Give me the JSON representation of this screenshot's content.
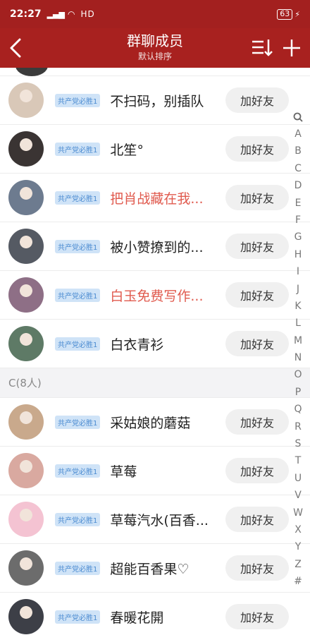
{
  "status": {
    "time": "22:27",
    "network": "HD",
    "battery": "63"
  },
  "header": {
    "title": "群聊成员",
    "subtitle": "默认排序"
  },
  "members_top": [
    {
      "name": "不扫码，别插队",
      "badge": "共产党必胜1",
      "button": "加好友",
      "highlight": false,
      "avatar_color": "#d9c8b8"
    },
    {
      "name": "北笙°",
      "badge": "共产党必胜1",
      "button": "加好友",
      "highlight": false,
      "avatar_color": "#3a3433"
    },
    {
      "name": "把肖战藏在我...",
      "badge": "共产党必胜1",
      "button": "加好友",
      "highlight": true,
      "avatar_color": "#6d7b8f"
    },
    {
      "name": "被小赞撩到的...",
      "badge": "共产党必胜1",
      "button": "加好友",
      "highlight": false,
      "avatar_color": "#555a63"
    },
    {
      "name": "白玉免费写作...",
      "badge": "共产党必胜1",
      "button": "加好友",
      "highlight": true,
      "avatar_color": "#8e6f86"
    },
    {
      "name": "白衣青衫",
      "badge": "共产党必胜1",
      "button": "加好友",
      "highlight": false,
      "avatar_color": "#5e7a66"
    }
  ],
  "section_c": {
    "label": "C(8人)"
  },
  "members_c": [
    {
      "name": "采姑娘的蘑菇",
      "badge": "共产党必胜1",
      "button": "加好友",
      "highlight": false,
      "avatar_color": "#c9a98c"
    },
    {
      "name": "草莓",
      "badge": "共产党必胜1",
      "button": "加好友",
      "highlight": false,
      "avatar_color": "#d9a9a0"
    },
    {
      "name": "草莓汽水(百香...",
      "badge": "共产党必胜1",
      "button": "加好友",
      "highlight": false,
      "avatar_color": "#f4c3d2"
    },
    {
      "name": "超能百香果♡",
      "badge": "共产党必胜1",
      "button": "加好友",
      "highlight": false,
      "avatar_color": "#6c6c6c"
    },
    {
      "name": "春暖花開",
      "badge": "共产党必胜1",
      "button": "加好友",
      "highlight": false,
      "avatar_color": "#3d3f47"
    }
  ],
  "index_letters": [
    "A",
    "B",
    "C",
    "D",
    "E",
    "F",
    "G",
    "H",
    "I",
    "J",
    "K",
    "L",
    "M",
    "N",
    "O",
    "P",
    "Q",
    "R",
    "S",
    "T",
    "U",
    "V",
    "W",
    "X",
    "Y",
    "Z",
    "#"
  ]
}
